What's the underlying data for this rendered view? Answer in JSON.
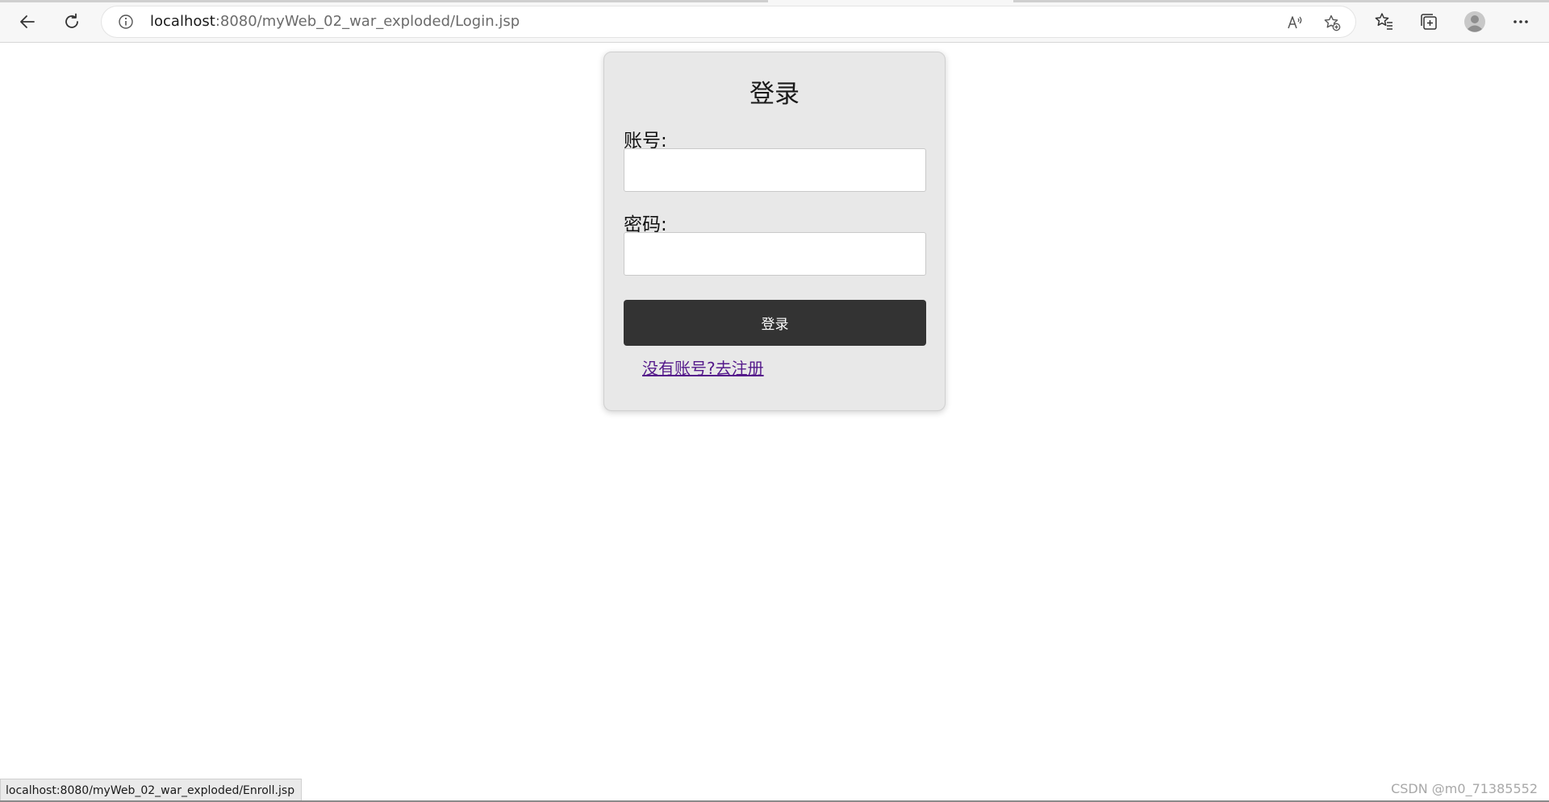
{
  "browser": {
    "url_host": "localhost",
    "url_path": ":8080/myWeb_02_war_exploded/Login.jsp",
    "icons": {
      "back": "back-arrow-icon",
      "refresh": "refresh-icon",
      "info": "info-icon",
      "read_aloud": "read-aloud-icon",
      "add_favorite": "add-favorite-icon",
      "favorites": "favorites-icon",
      "collections": "collections-icon",
      "profile": "profile-icon",
      "more": "more-icon"
    }
  },
  "login_form": {
    "title": "登录",
    "account_label": "账号:",
    "account_value": "",
    "password_label": "密码:",
    "password_value": "",
    "submit_label": "登录",
    "register_link": "没有账号?去注册"
  },
  "status_bar": {
    "hover_url": "localhost:8080/myWeb_02_war_exploded/Enroll.jsp"
  },
  "watermark": {
    "text": "CSDN @m0_71385552"
  },
  "colors": {
    "card_background": "#e8e8e8",
    "button_background": "#333333",
    "link_color": "#551a8b"
  }
}
